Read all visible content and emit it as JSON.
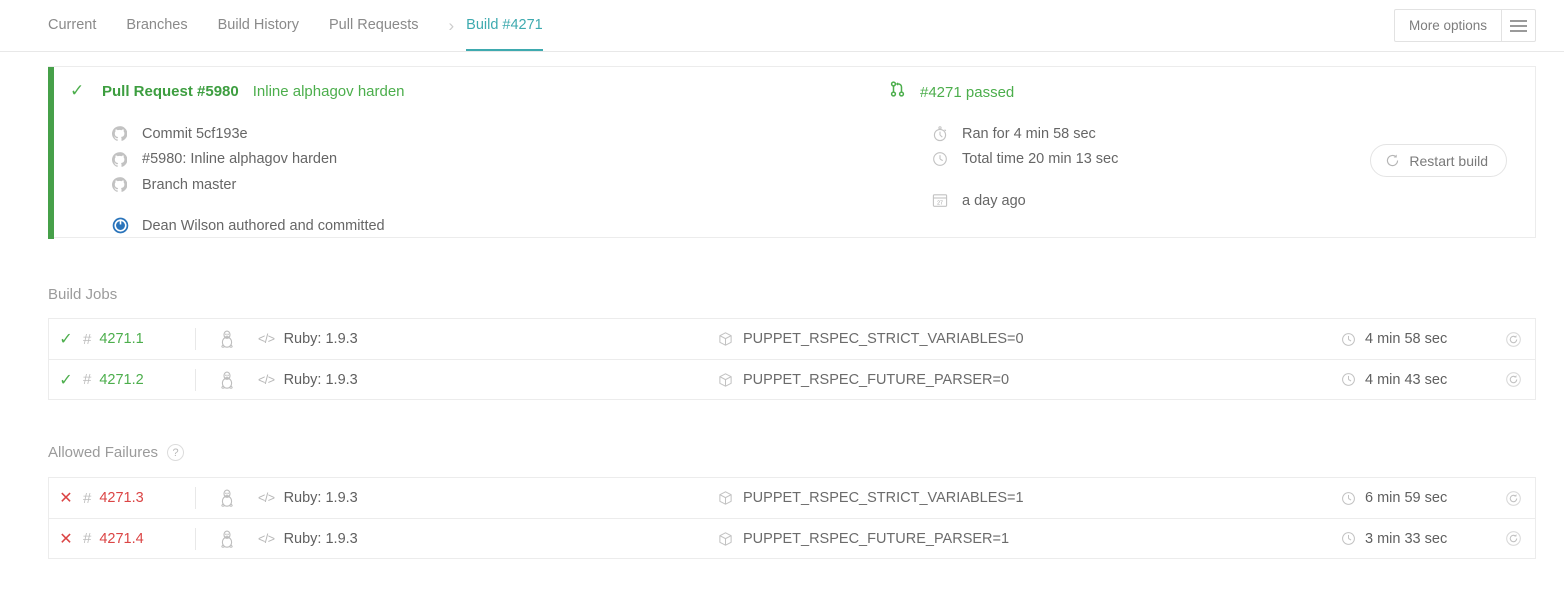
{
  "nav": {
    "tabs": [
      {
        "label": "Current",
        "active": false
      },
      {
        "label": "Branches",
        "active": false
      },
      {
        "label": "Build History",
        "active": false
      },
      {
        "label": "Pull Requests",
        "active": false
      },
      {
        "label": "Build #4271",
        "active": true
      }
    ],
    "separator": "›",
    "more_options_label": "More options"
  },
  "summary": {
    "state_icon": "✓",
    "pull_request_label": "Pull Request #5980",
    "pull_request_title": "Inline alphagov harden",
    "commit": "Commit 5cf193e",
    "pr_line": "#5980: Inline alphagov harden",
    "branch": "Branch master",
    "author": "Dean Wilson authored and committed",
    "build_status": "#4271 passed",
    "ran_for": "Ran for 4 min 58 sec",
    "total_time": "Total time 20 min 13 sec",
    "when": "a day ago",
    "calendar_day": "27",
    "restart_label": "Restart build",
    "accent_color": "#46a049"
  },
  "build_jobs": {
    "title": "Build Jobs",
    "rows": [
      {
        "state": "passed",
        "state_icon": "✓",
        "hash": "#",
        "number": "4271.1",
        "os": "linux",
        "language": "Ruby: 1.9.3",
        "env": "PUPPET_RSPEC_STRICT_VARIABLES=0",
        "duration": "4 min 58 sec"
      },
      {
        "state": "passed",
        "state_icon": "✓",
        "hash": "#",
        "number": "4271.2",
        "os": "linux",
        "language": "Ruby: 1.9.3",
        "env": "PUPPET_RSPEC_FUTURE_PARSER=0",
        "duration": "4 min 43 sec"
      }
    ]
  },
  "allowed_failures": {
    "title": "Allowed Failures",
    "help_glyph": "?",
    "rows": [
      {
        "state": "failed",
        "state_icon": "✕",
        "hash": "#",
        "number": "4271.3",
        "os": "linux",
        "language": "Ruby: 1.9.3",
        "env": "PUPPET_RSPEC_STRICT_VARIABLES=1",
        "duration": "6 min 59 sec"
      },
      {
        "state": "failed",
        "state_icon": "✕",
        "hash": "#",
        "number": "4271.4",
        "os": "linux",
        "language": "Ruby: 1.9.3",
        "env": "PUPPET_RSPEC_FUTURE_PARSER=1",
        "duration": "3 min 33 sec"
      }
    ]
  },
  "colors": {
    "pass_green": "#4cae4c",
    "fail_red": "#db4545",
    "active_teal": "#3eaaaf",
    "muted": "#9b9b9b"
  }
}
